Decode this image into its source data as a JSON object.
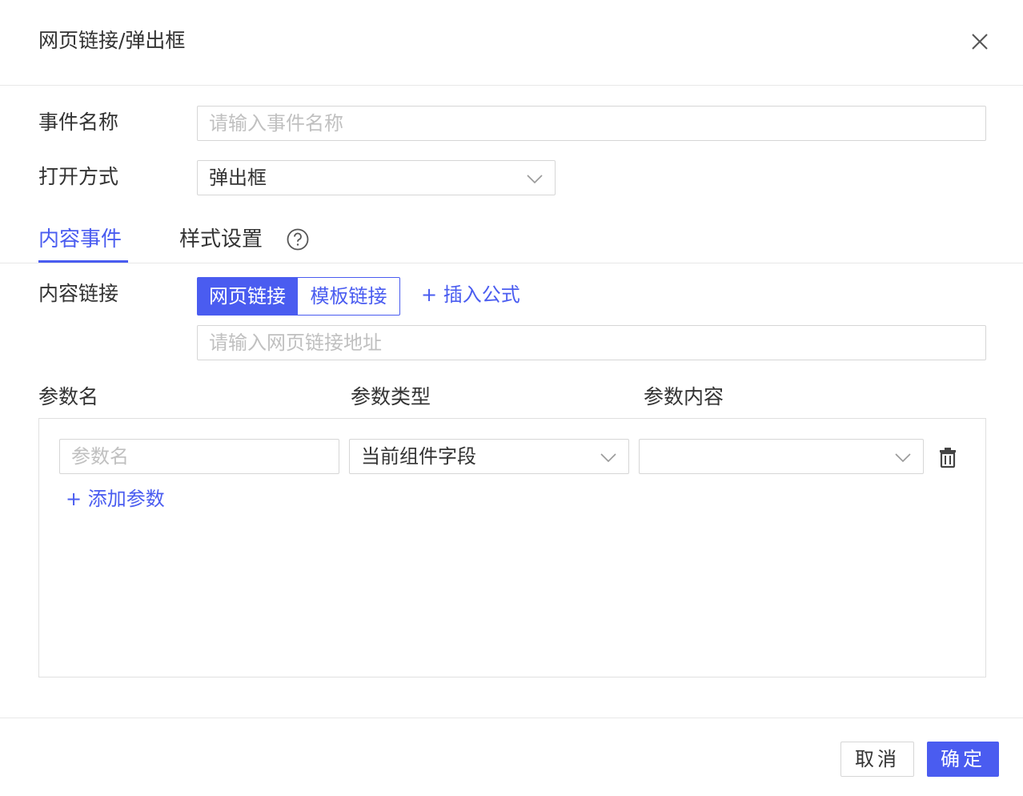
{
  "dialog": {
    "title": "网页链接/弹出框"
  },
  "form": {
    "event_name_label": "事件名称",
    "event_name_value": "",
    "event_name_placeholder": "请输入事件名称",
    "open_mode_label": "打开方式",
    "open_mode_value": "弹出框"
  },
  "tabs": [
    {
      "label": "内容事件",
      "active": true
    },
    {
      "label": "样式设置",
      "active": false
    }
  ],
  "content_link": {
    "label": "内容链接",
    "segments": [
      {
        "label": "网页链接",
        "selected": true
      },
      {
        "label": "模板链接",
        "selected": false
      }
    ],
    "insert_formula_label": "+ 插入公式",
    "url_value": "",
    "url_placeholder": "请输入网页链接地址"
  },
  "params": {
    "columns": [
      "参数名",
      "参数类型",
      "参数内容"
    ],
    "rows": [
      {
        "name_value": "",
        "name_placeholder": "参数名",
        "type_value": "当前组件字段",
        "content_value": ""
      }
    ],
    "add_label": "+ 添加参数"
  },
  "footer": {
    "cancel_label": "取消",
    "ok_label": "确定"
  },
  "colors": {
    "accent": "#4a5cf0",
    "text": "#333333",
    "placeholder": "#c0c0c0",
    "border": "#d6d6d6"
  },
  "icons": {
    "close": "close-icon",
    "help": "question-circle-icon",
    "dropdown": "chevron-down-icon",
    "delete": "trash-icon"
  }
}
